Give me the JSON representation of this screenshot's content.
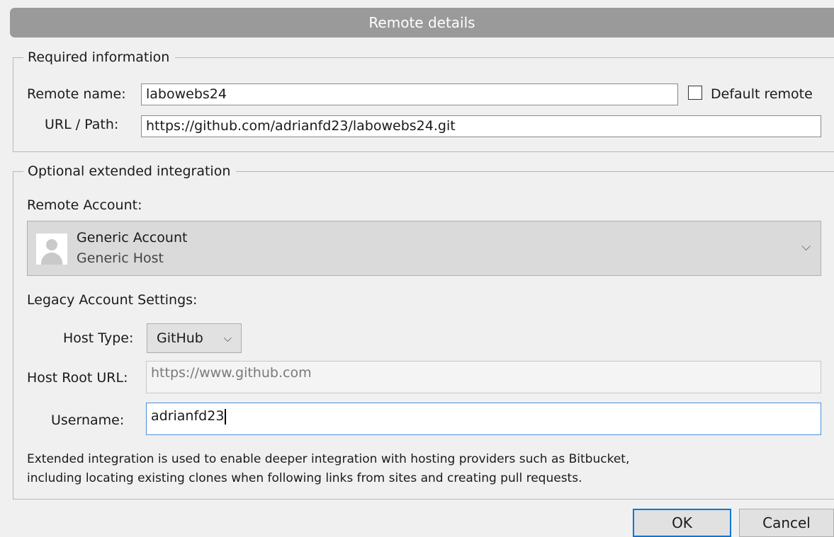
{
  "window": {
    "title": "Remote details"
  },
  "required": {
    "legend": "Required information",
    "remote_name_label": "Remote name:",
    "remote_name_value": "labowebs24",
    "default_remote_label": "Default remote",
    "default_remote_checked": false,
    "url_label": "URL / Path:",
    "url_value": "https://github.com/adrianfd23/labowebs24.git"
  },
  "optional": {
    "legend": "Optional extended integration",
    "remote_account_label": "Remote Account:",
    "account_name": "Generic Account",
    "account_host": "Generic Host",
    "legacy_label": "Legacy Account Settings:",
    "host_type_label": "Host Type:",
    "host_type_value": "GitHub",
    "host_root_label": "Host Root URL:",
    "host_root_value": "https://www.github.com",
    "username_label": "Username:",
    "username_value": "adrianfd23",
    "note_line1": "Extended integration is used to enable deeper integration with hosting providers such as Bitbucket,",
    "note_line2": "including locating existing clones when following links from sites and creating pull requests."
  },
  "buttons": {
    "ok": "OK",
    "cancel": "Cancel"
  },
  "icons": {
    "account_dropdown": "chevron-down-icon",
    "host_type_dropdown": "chevron-down-icon",
    "avatar": "user-avatar-icon"
  },
  "colors": {
    "titlebar": "#9a9a9a",
    "focus": "#0078d7"
  }
}
